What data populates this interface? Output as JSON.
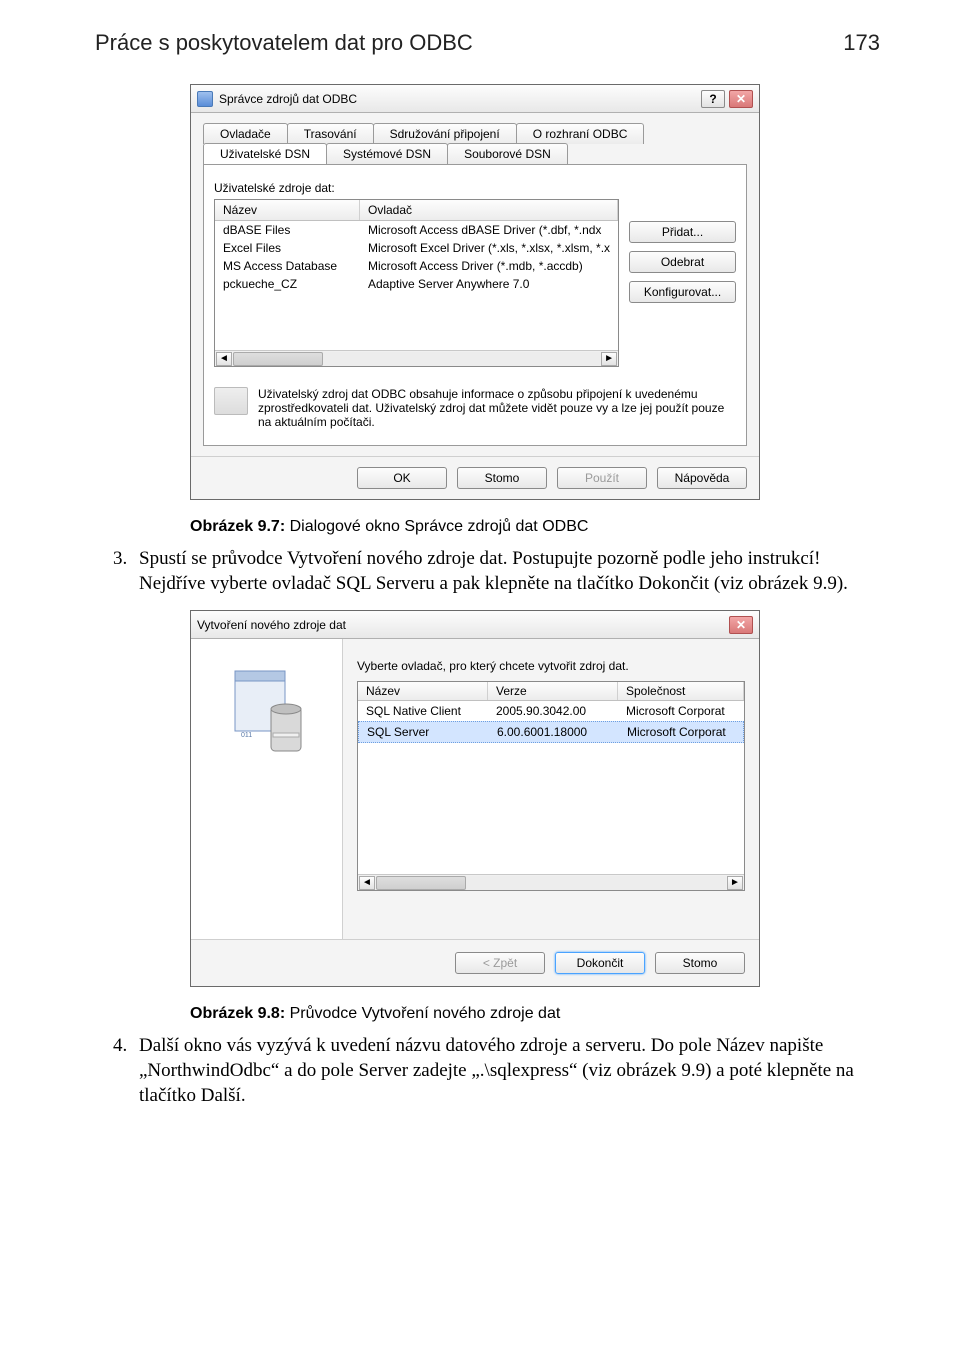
{
  "header": {
    "title": "Práce s poskytovatelem dat pro ODBC",
    "page": "173"
  },
  "dlg1": {
    "title": "Správce zdrojů dat ODBC",
    "help_btn": "?",
    "close_btn": "✕",
    "tabs_row1": [
      "Ovladače",
      "Trasování",
      "Sdružování připojení",
      "O rozhraní ODBC"
    ],
    "tabs_row2": [
      "Uživatelské DSN",
      "Systémové DSN",
      "Souborové DSN"
    ],
    "tab_selected": "Uživatelské DSN",
    "list_label": "Uživatelské zdroje dat:",
    "columns": [
      "Název",
      "Ovladač"
    ],
    "rows": [
      {
        "name": "dBASE Files",
        "drv": "Microsoft Access dBASE Driver (*.dbf, *.ndx"
      },
      {
        "name": "Excel Files",
        "drv": "Microsoft Excel Driver (*.xls, *.xlsx, *.xlsm, *.x"
      },
      {
        "name": "MS Access Database",
        "drv": "Microsoft Access Driver (*.mdb, *.accdb)"
      },
      {
        "name": "pckueche_CZ",
        "drv": "Adaptive Server Anywhere 7.0"
      }
    ],
    "side_buttons": {
      "add": "Přidat...",
      "remove": "Odebrat",
      "config": "Konfigurovat..."
    },
    "info": "Uživatelský zdroj dat ODBC obsahuje informace o způsobu připojení k uvedenému zprostředkovateli dat. Uživatelský zdroj dat můžete vidět pouze vy a lze jej použít pouze na aktuálním počítači.",
    "buttons": {
      "ok": "OK",
      "cancel": "Stomo",
      "apply": "Použít",
      "help": "Nápověda"
    }
  },
  "caption1": {
    "b": "Obrázek 9.7:",
    "t": " Dialogové okno Správce zdrojů dat ODBC"
  },
  "para1": {
    "marker": "3.",
    "text": "Spustí se průvodce Vytvoření nového zdroje dat. Postupujte pozorně podle jeho instrukcí! Nejdříve vyberte ovladač SQL Serveru a pak klepněte na tlačítko Dokončit (viz obrázek 9.9)."
  },
  "dlg2": {
    "title": "Vytvoření nového zdroje dat",
    "close_btn": "✕",
    "prompt": "Vyberte ovladač, pro který chcete vytvořit zdroj dat.",
    "columns": [
      "Název",
      "Verze",
      "Společnost"
    ],
    "rows": [
      {
        "name": "SQL Native Client",
        "ver": "2005.90.3042.00",
        "co": "Microsoft Corporat"
      },
      {
        "name": "SQL Server",
        "ver": "6.00.6001.18000",
        "co": "Microsoft Corporat"
      }
    ],
    "buttons": {
      "back": "< Zpět",
      "finish": "Dokončit",
      "cancel": "Stomo"
    }
  },
  "caption2": {
    "b": "Obrázek 9.8:",
    "t": " Průvodce Vytvoření nového zdroje dat"
  },
  "para2": {
    "marker": "4.",
    "text": "Další okno vás vyzývá k uvedení názvu datového zdroje a serveru. Do pole Název napište „NorthwindOdbc“ a do pole Server zadejte „.\\sqlexpress“ (viz obrázek 9.9) a poté klepněte na tlačítko Další."
  }
}
